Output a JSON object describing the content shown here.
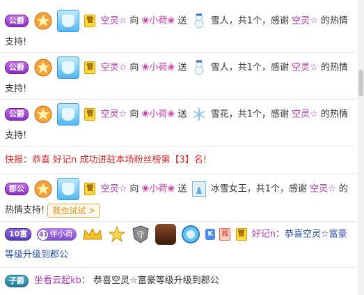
{
  "messages": [
    {
      "type": "gift",
      "rank_tag": "公爵",
      "guan_label": "管",
      "sender": "空灵☆",
      "verb_to": "向",
      "receiver": "❀小荷❀",
      "verb_send": "送",
      "gift_name": "雪人，共1个，感谢",
      "thank_name": "空灵☆",
      "tail": "的热情支持!"
    },
    {
      "type": "gift",
      "rank_tag": "公爵",
      "guan_label": "管",
      "sender": "空灵☆",
      "verb_to": "向",
      "receiver": "❀小荷❀",
      "verb_send": "送",
      "gift_name": "雪人，共1个，感谢",
      "thank_name": "空灵☆",
      "tail": "的热情支持!"
    },
    {
      "type": "gift",
      "rank_tag": "公爵",
      "guan_label": "管",
      "sender": "空灵☆",
      "verb_to": "向",
      "receiver": "❀小荷❀",
      "verb_send": "送",
      "gift_name": "雪花，共1个，感谢",
      "thank_name": "空灵☆",
      "tail": "的热情支持!"
    },
    {
      "type": "news",
      "text": "快报：恭喜 好记n 成功进驻本场粉丝榜第【3】名!"
    },
    {
      "type": "gift",
      "rank_tag": "郡公",
      "guan_label": "管",
      "sender": "空灵☆",
      "verb_to": "向",
      "receiver": "❀小荷❀",
      "verb_send": "送",
      "gift_name": "冰雪女王，共1个，感谢",
      "thank_name": "空灵☆",
      "tail": "的热情支持!",
      "button": "我也试试 >"
    },
    {
      "type": "upgrade",
      "rank_tag": "10富",
      "fan_level": "41",
      "fan_name": "伴小荷",
      "k_label": "K",
      "red_label": "履",
      "guan_label": "管",
      "sender": "好记n",
      "colon": "：",
      "text": "恭喜空灵☆富豪等级升级到郡公"
    },
    {
      "type": "chat",
      "rank_tag": "子爵",
      "sender": "坐看云起kb",
      "colon": "：",
      "text": "恭喜空灵☆富豪等级升级到郡公"
    }
  ],
  "colors": {
    "sender": "#b03ab0",
    "receiver": "#c83aa8",
    "system": "#d02828",
    "upgrade_text": "#2a4fa8"
  }
}
